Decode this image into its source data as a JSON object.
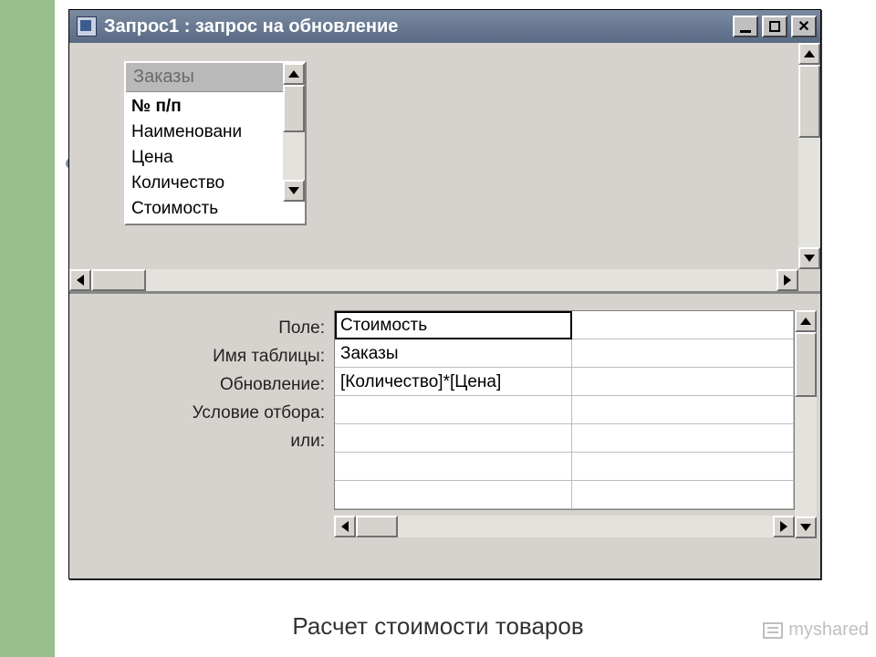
{
  "window": {
    "title": "Запрос1 : запрос на обновление"
  },
  "table_box": {
    "title": "Заказы",
    "fields": {
      "pk": "№ п/п",
      "f1": "Наименовани",
      "f2": "Цена",
      "f3": "Количество",
      "f4": "Стоимость"
    }
  },
  "grid": {
    "labels": {
      "field": "Поле:",
      "table": "Имя таблицы:",
      "update": "Обновление:",
      "criteria": "Условие отбора:",
      "or": "или:"
    },
    "col1": {
      "field": "Стоимость",
      "table": "Заказы",
      "update": "[Количество]*[Цена]",
      "criteria": "",
      "or": ""
    }
  },
  "caption": "Расчет стоимости товаров",
  "watermark": "myshared"
}
